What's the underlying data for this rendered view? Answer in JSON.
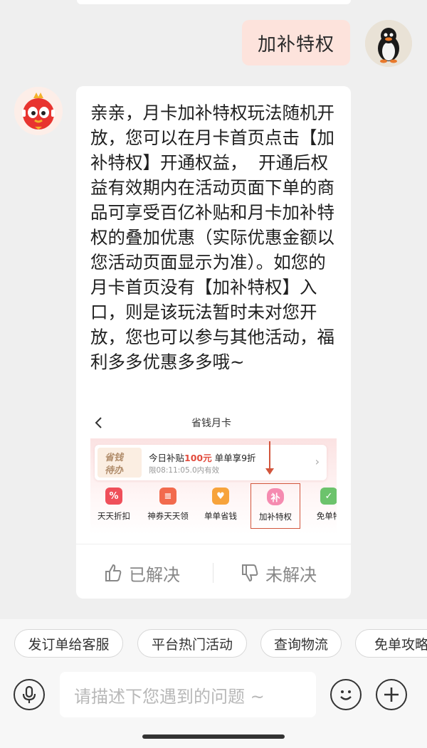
{
  "user_message": "加补特权",
  "bot_message": "亲亲，月卡加补特权玩法随机开放，您可以在月卡首页点击【加补特权】开通权益，  开通后权益有效期内在活动页面下单的商品可享受百亿补贴和月卡加补特权的叠加优惠（实际优惠金额以您活动页面显示为准）。如您的月卡首页没有【加补特权】入口，则是该玩法暂时未对您开放，您也可以参与其他活动，福利多多优惠多多哦~",
  "embedded": {
    "title": "省钱月卡",
    "promo_logo_line1": "省钱",
    "promo_logo_line2": "待办",
    "promo_line1_prefix": "今日补贴",
    "promo_line1_amount": "100元",
    "promo_line1_suffix": " 单单享9折",
    "promo_line2": "限08:11:05.0内有效",
    "features": [
      {
        "label": "天天折扣",
        "glyph": "%",
        "color": "#ef4f5a"
      },
      {
        "label": "神券天天领",
        "glyph": "≡",
        "color": "#f26a4d"
      },
      {
        "label": "单单省钱",
        "glyph": "♥",
        "color": "#f7a33b"
      },
      {
        "label": "加补特权",
        "glyph": "补",
        "color": "#f58bb0"
      },
      {
        "label": "免单特",
        "glyph": "✓",
        "color": "#6cc36c"
      }
    ]
  },
  "feedback": {
    "solved": "已解决",
    "unsolved": "未解决"
  },
  "quick_replies": [
    "发订单给客服",
    "平台热门活动",
    "查询物流",
    "免单攻略"
  ],
  "input": {
    "placeholder": "请描述下您遇到的问题 ~"
  },
  "colors": {
    "accent": "#d2553c",
    "user_bubble": "#fde3dc",
    "highlight_red": "#e24b3c"
  }
}
